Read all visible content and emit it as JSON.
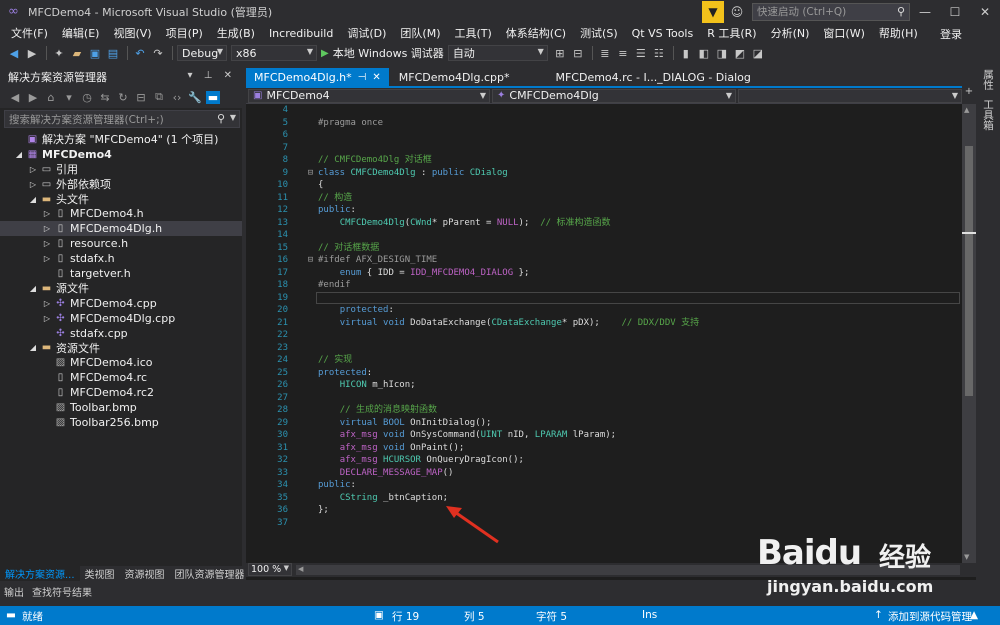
{
  "window": {
    "title": "MFCDemo4 - Microsoft Visual Studio (管理员)",
    "quick_launch_placeholder": "快速启动 (Ctrl+Q)"
  },
  "menu": [
    "文件(F)",
    "编辑(E)",
    "视图(V)",
    "项目(P)",
    "生成(B)",
    "Incredibuild",
    "调试(D)",
    "团队(M)",
    "工具(T)",
    "体系结构(C)",
    "测试(S)",
    "Qt VS Tools",
    "R 工具(R)",
    "分析(N)",
    "窗口(W)",
    "帮助(H)"
  ],
  "login_label": "登录",
  "toolbar": {
    "config": "Debug",
    "platform": "x86",
    "run_label": "本地 Windows 调试器",
    "run_mode": "自动"
  },
  "solution_explorer": {
    "title": "解决方案资源管理器",
    "search_placeholder": "搜索解决方案资源管理器(Ctrl+;)",
    "items": [
      {
        "label": "解决方案 \"MFCDemo4\" (1 个项目)",
        "indent": 0,
        "icon": "solution-icon",
        "expander": ""
      },
      {
        "label": "MFCDemo4",
        "indent": 0,
        "icon": "project-icon",
        "expander": "expanded",
        "bold": true
      },
      {
        "label": "引用",
        "indent": 1,
        "icon": "references-icon",
        "expander": "collapsed"
      },
      {
        "label": "外部依赖项",
        "indent": 1,
        "icon": "external-deps-icon",
        "expander": "collapsed"
      },
      {
        "label": "头文件",
        "indent": 1,
        "icon": "folder-icon",
        "expander": "expanded"
      },
      {
        "label": "MFCDemo4.h",
        "indent": 2,
        "icon": "header-file-icon",
        "expander": "collapsed"
      },
      {
        "label": "MFCDemo4Dlg.h",
        "indent": 2,
        "icon": "header-file-icon",
        "expander": "collapsed",
        "selected": true
      },
      {
        "label": "resource.h",
        "indent": 2,
        "icon": "header-file-icon",
        "expander": "collapsed"
      },
      {
        "label": "stdafx.h",
        "indent": 2,
        "icon": "header-file-icon",
        "expander": "collapsed"
      },
      {
        "label": "targetver.h",
        "indent": 2,
        "icon": "header-file-icon",
        "expander": ""
      },
      {
        "label": "源文件",
        "indent": 1,
        "icon": "folder-icon",
        "expander": "expanded"
      },
      {
        "label": "MFCDemo4.cpp",
        "indent": 2,
        "icon": "cpp-file-icon",
        "expander": "collapsed"
      },
      {
        "label": "MFCDemo4Dlg.cpp",
        "indent": 2,
        "icon": "cpp-file-icon",
        "expander": "collapsed"
      },
      {
        "label": "stdafx.cpp",
        "indent": 2,
        "icon": "cpp-file-icon",
        "expander": ""
      },
      {
        "label": "资源文件",
        "indent": 1,
        "icon": "folder-icon",
        "expander": "expanded"
      },
      {
        "label": "MFCDemo4.ico",
        "indent": 2,
        "icon": "image-file-icon",
        "expander": ""
      },
      {
        "label": "MFCDemo4.rc",
        "indent": 2,
        "icon": "resource-file-icon",
        "expander": ""
      },
      {
        "label": "MFCDemo4.rc2",
        "indent": 2,
        "icon": "resource-file-icon",
        "expander": ""
      },
      {
        "label": "Toolbar.bmp",
        "indent": 2,
        "icon": "image-file-icon",
        "expander": ""
      },
      {
        "label": "Toolbar256.bmp",
        "indent": 2,
        "icon": "image-file-icon",
        "expander": ""
      }
    ],
    "tabs": [
      "解决方案资源...",
      "类视图",
      "资源视图",
      "团队资源管理器"
    ]
  },
  "bottom_tabs": [
    "输出",
    "查找符号结果"
  ],
  "editor": {
    "tabs": [
      {
        "label": "MFCDemo4Dlg.h*",
        "active": true
      },
      {
        "label": "MFCDemo4Dlg.cpp*",
        "active": false
      },
      {
        "label": "MFCDemo4.rc - I..._DIALOG - Dialog",
        "active": false
      }
    ],
    "nav_left": "MFCDemo4",
    "nav_right": "CMFCDemo4Dlg",
    "zoom": "100 %",
    "line_numbers": [
      "4",
      "5",
      "6",
      "7",
      "8",
      "9",
      "10",
      "11",
      "12",
      "13",
      "14",
      "15",
      "16",
      "17",
      "18",
      "19",
      "20",
      "21",
      "22",
      "23",
      "24",
      "25",
      "26",
      "27",
      "28",
      "29",
      "30",
      "31",
      "32",
      "33",
      "34",
      "35",
      "36",
      "37"
    ],
    "lines": [
      "",
      "#pragma once",
      "",
      "",
      "// CMFCDemo4Dlg 对话框",
      "class CMFCDemo4Dlg : public CDialog",
      "{",
      "// 构造",
      "public:",
      "    CMFCDemo4Dlg(CWnd* pParent = NULL);  // 标准构造函数",
      "",
      "// 对话框数据",
      "#ifdef AFX_DESIGN_TIME",
      "    enum { IDD = IDD_MFCDEMO4_DIALOG };",
      "#endif",
      "",
      "    protected:",
      "    virtual void DoDataExchange(CDataExchange* pDX);    // DDX/DDV 支持",
      "",
      "",
      "// 实现",
      "protected:",
      "    HICON m_hIcon;",
      "",
      "    // 生成的消息映射函数",
      "    virtual BOOL OnInitDialog();",
      "    afx_msg void OnSysCommand(UINT nID, LPARAM lParam);",
      "    afx_msg void OnPaint();",
      "    afx_msg HCURSOR OnQueryDragIcon();",
      "    DECLARE_MESSAGE_MAP()",
      "public:",
      "    CString _btnCaption;",
      "};",
      ""
    ]
  },
  "right_rail": [
    "属性",
    "工具箱"
  ],
  "status_bar": {
    "ready": "就绪",
    "line": "行 19",
    "col": "列 5",
    "char": "字符 5",
    "mode": "Ins",
    "source_control": "添加到源代码管理"
  },
  "watermark": {
    "brand": "Baidu",
    "name": "经验",
    "url": "jingyan.baidu.com"
  },
  "colors": {
    "accent": "#007acc",
    "background": "#1e1e1e",
    "chrome": "#2d2d30",
    "keyword": "#569cd6",
    "comment": "#57a64a",
    "line_number": "#2b91af"
  }
}
